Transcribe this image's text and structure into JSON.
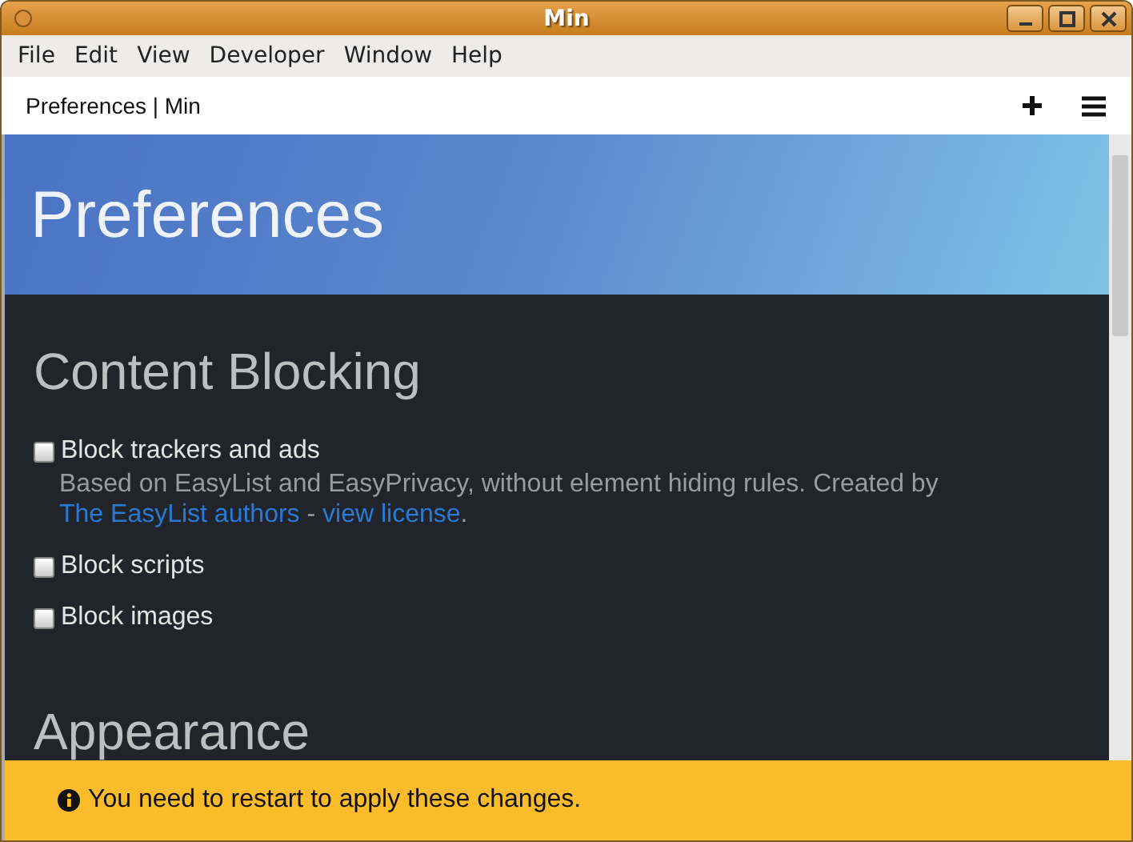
{
  "window": {
    "title": "Min"
  },
  "menu": [
    "File",
    "Edit",
    "View",
    "Developer",
    "Window",
    "Help"
  ],
  "tab_bar": {
    "title": "Preferences | Min"
  },
  "page": {
    "header": "Preferences",
    "sections": [
      {
        "heading": "Content Blocking",
        "options": [
          {
            "label": "Block trackers and ads",
            "checked": false,
            "description": [
              {
                "kind": "text",
                "text": "Based on EasyList and EasyPrivacy, without element hiding rules. Created by "
              },
              {
                "kind": "link",
                "text": "The EasyList authors"
              },
              {
                "kind": "text",
                "text": " - "
              },
              {
                "kind": "link",
                "text": "view license"
              },
              {
                "kind": "text",
                "text": "."
              }
            ]
          },
          {
            "label": "Block scripts",
            "checked": false
          },
          {
            "label": "Block images",
            "checked": false
          }
        ]
      },
      {
        "heading": "Appearance"
      }
    ]
  },
  "banner": {
    "message": "You need to restart to apply these changes."
  }
}
